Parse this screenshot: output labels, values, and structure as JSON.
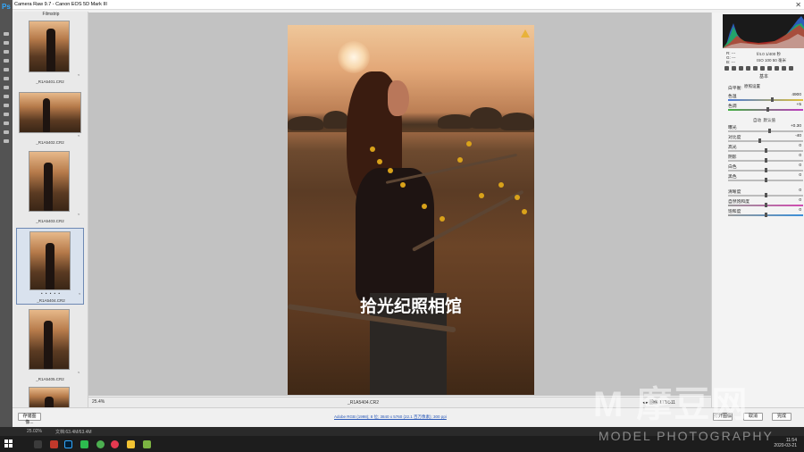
{
  "app": {
    "title": "Camera Raw 9.7  -  Canon EOS 5D Mark III",
    "ps_logo": "Ps"
  },
  "filmstrip": {
    "header": "Filmstrip",
    "thumbs": [
      {
        "name": "_R1A5401.CR2"
      },
      {
        "name": "_R1A5402.CR2"
      },
      {
        "name": "_R1A5403.CR2"
      },
      {
        "name": "_R1A5404.CR2",
        "stars": "• • • • •"
      },
      {
        "name": "_R1A5405.CR2"
      },
      {
        "name": ""
      }
    ]
  },
  "canvas": {
    "watermark": "拾光纪照相馆",
    "zoom": "25.4%",
    "filename": "_R1A5404.CR2",
    "pager": "◂ ▸  图像 171/511"
  },
  "right_panel": {
    "info": {
      "r": "R:  ---",
      "g": "G:  ---",
      "b": "B:  ---",
      "exposure": "f/4.0   1/400 秒",
      "iso": "ISO 100   50 毫米"
    },
    "section": "基本",
    "wb_label": "白平衡:",
    "wb_value": "原照设置",
    "sliders": [
      {
        "label": "色温",
        "value": "4900"
      },
      {
        "label": "色调",
        "value": "+5"
      },
      {
        "label": "曝光",
        "value": "+0.30"
      },
      {
        "label": "对比度",
        "value": "-40"
      },
      {
        "label": "高光",
        "value": "0"
      },
      {
        "label": "阴影",
        "value": "0"
      },
      {
        "label": "白色",
        "value": "0"
      },
      {
        "label": "黑色",
        "value": "0"
      },
      {
        "label": "清晰度",
        "value": "0"
      },
      {
        "label": "自然饱和度",
        "value": "0"
      },
      {
        "label": "饱和度",
        "value": "0"
      }
    ],
    "auto_label": "自动",
    "default_label": "默认值"
  },
  "bottom": {
    "select_all": "存储图像...",
    "workflow": "Adobe RGB (1998); 8 位; 3840 x 5760 (22.1 百万像素); 300 ppi",
    "open_image": "打开图像",
    "cancel": "取消",
    "done": "完成"
  },
  "status": {
    "zoom": "25.02%",
    "doc": "文档:63.4M/63.4M"
  },
  "taskbar": {
    "time": "11:54",
    "date": "2020-03-21"
  },
  "brand": {
    "big": "M 摩豆网",
    "small": "MODEL PHOTOGRAPHY"
  },
  "colors": {
    "accent": "#31a8ff",
    "selection": "#6d88b3"
  }
}
